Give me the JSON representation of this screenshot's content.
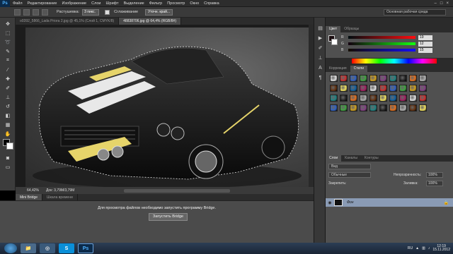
{
  "app": {
    "logo": "Ps"
  },
  "menu": [
    "Файл",
    "Редактирование",
    "Изображение",
    "Слои",
    "Шрифт",
    "Выделение",
    "Фильтр",
    "Просмотр",
    "Окно",
    "Справка"
  ],
  "options": {
    "feather_label": "Растушевка:",
    "feather_value": "3 пикс.",
    "antialias_label": "Сглаживание",
    "refine_edge": "Уточн. край...",
    "workspace": "Основная рабочая среда"
  },
  "tabs": [
    {
      "label": "o0392_5866_Lada Priora 2.jpg @ 45,1% (Слой 1, CMYK/8)",
      "active": false
    },
    {
      "label": "48838706.jpg @ 64,4% (RGB/8#)",
      "active": true
    }
  ],
  "status": {
    "zoom": "64,42%",
    "doc": "Док: 3,79M/3,79M"
  },
  "bridge": {
    "tabs": [
      "Mini Bridge",
      "Шкала времени"
    ],
    "message": "Для просмотра файлов необходимо запустить программу Bridge.",
    "button": "Запустить Bridge"
  },
  "color_panel": {
    "tabs": [
      "Цвет",
      "Образцы"
    ],
    "r": "19",
    "g": "12",
    "b": "15",
    "labels": [
      "R",
      "G",
      "B"
    ]
  },
  "styles_panel": {
    "tabs": [
      "Коррекция",
      "Стили"
    ]
  },
  "layers_panel": {
    "tabs": [
      "Слои",
      "Каналы",
      "Контуры"
    ],
    "filter": "Вид",
    "blend": "Обычные",
    "opacity_label": "Непрозрачность:",
    "opacity": "100%",
    "lock_label": "Закрепить:",
    "fill_label": "Заливка:",
    "fill": "100%",
    "layer_name": "Фон"
  },
  "taskbar": {
    "lang": "RU",
    "time": "12:19",
    "date": "15.11.2012"
  },
  "colors": {
    "accent": "#3d7fd6",
    "layer_selected": "#8a9bb5"
  }
}
